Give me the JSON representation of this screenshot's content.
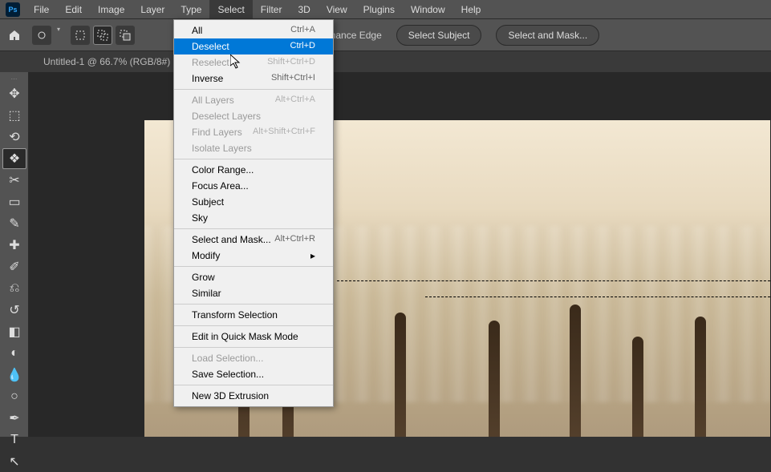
{
  "menubar": {
    "items": [
      "File",
      "Edit",
      "Image",
      "Layer",
      "Type",
      "Select",
      "Filter",
      "3D",
      "View",
      "Plugins",
      "Window",
      "Help"
    ],
    "active_index": 5
  },
  "optionsbar": {
    "enhance_edge": "Enhance Edge",
    "select_subject": "Select Subject",
    "select_and_mask": "Select and Mask..."
  },
  "document": {
    "tab_label": "Untitled-1 @ 66.7% (RGB/8#)"
  },
  "select_menu": {
    "items": [
      {
        "label": "All",
        "shortcut": "Ctrl+A",
        "disabled": false
      },
      {
        "label": "Deselect",
        "shortcut": "Ctrl+D",
        "disabled": false,
        "selected": true
      },
      {
        "label": "Reselect",
        "shortcut": "Shift+Ctrl+D",
        "disabled": true
      },
      {
        "label": "Inverse",
        "shortcut": "Shift+Ctrl+I",
        "disabled": false
      },
      {
        "sep": true
      },
      {
        "label": "All Layers",
        "shortcut": "Alt+Ctrl+A",
        "disabled": true
      },
      {
        "label": "Deselect Layers",
        "shortcut": "",
        "disabled": true
      },
      {
        "label": "Find Layers",
        "shortcut": "Alt+Shift+Ctrl+F",
        "disabled": true
      },
      {
        "label": "Isolate Layers",
        "shortcut": "",
        "disabled": true
      },
      {
        "sep": true
      },
      {
        "label": "Color Range...",
        "shortcut": "",
        "disabled": false
      },
      {
        "label": "Focus Area...",
        "shortcut": "",
        "disabled": false
      },
      {
        "label": "Subject",
        "shortcut": "",
        "disabled": false
      },
      {
        "label": "Sky",
        "shortcut": "",
        "disabled": false
      },
      {
        "sep": true
      },
      {
        "label": "Select and Mask...",
        "shortcut": "Alt+Ctrl+R",
        "disabled": false
      },
      {
        "label": "Modify",
        "shortcut": "",
        "disabled": false,
        "submenu": true
      },
      {
        "sep": true
      },
      {
        "label": "Grow",
        "shortcut": "",
        "disabled": false
      },
      {
        "label": "Similar",
        "shortcut": "",
        "disabled": false
      },
      {
        "sep": true
      },
      {
        "label": "Transform Selection",
        "shortcut": "",
        "disabled": false
      },
      {
        "sep": true
      },
      {
        "label": "Edit in Quick Mask Mode",
        "shortcut": "",
        "disabled": false
      },
      {
        "sep": true
      },
      {
        "label": "Load Selection...",
        "shortcut": "",
        "disabled": true
      },
      {
        "label": "Save Selection...",
        "shortcut": "",
        "disabled": false
      },
      {
        "sep": true
      },
      {
        "label": "New 3D Extrusion",
        "shortcut": "",
        "disabled": false
      }
    ]
  },
  "tools": [
    {
      "name": "move-tool",
      "glyph": "✥"
    },
    {
      "name": "marquee-tool",
      "glyph": "⬚"
    },
    {
      "name": "lasso-tool",
      "glyph": "⟲"
    },
    {
      "name": "quick-select-tool",
      "glyph": "❖",
      "active": true
    },
    {
      "name": "crop-tool",
      "glyph": "✂"
    },
    {
      "name": "frame-tool",
      "glyph": "▭"
    },
    {
      "name": "eyedropper-tool",
      "glyph": "✎"
    },
    {
      "name": "healing-tool",
      "glyph": "✚"
    },
    {
      "name": "brush-tool",
      "glyph": "✐"
    },
    {
      "name": "stamp-tool",
      "glyph": "⎌"
    },
    {
      "name": "history-brush-tool",
      "glyph": "↺"
    },
    {
      "name": "eraser-tool",
      "glyph": "◧"
    },
    {
      "name": "gradient-tool",
      "glyph": "◐"
    },
    {
      "name": "blur-tool",
      "glyph": "💧"
    },
    {
      "name": "dodge-tool",
      "glyph": "○"
    },
    {
      "name": "pen-tool",
      "glyph": "✒"
    },
    {
      "name": "type-tool",
      "glyph": "T"
    },
    {
      "name": "path-tool",
      "glyph": "↖"
    }
  ]
}
